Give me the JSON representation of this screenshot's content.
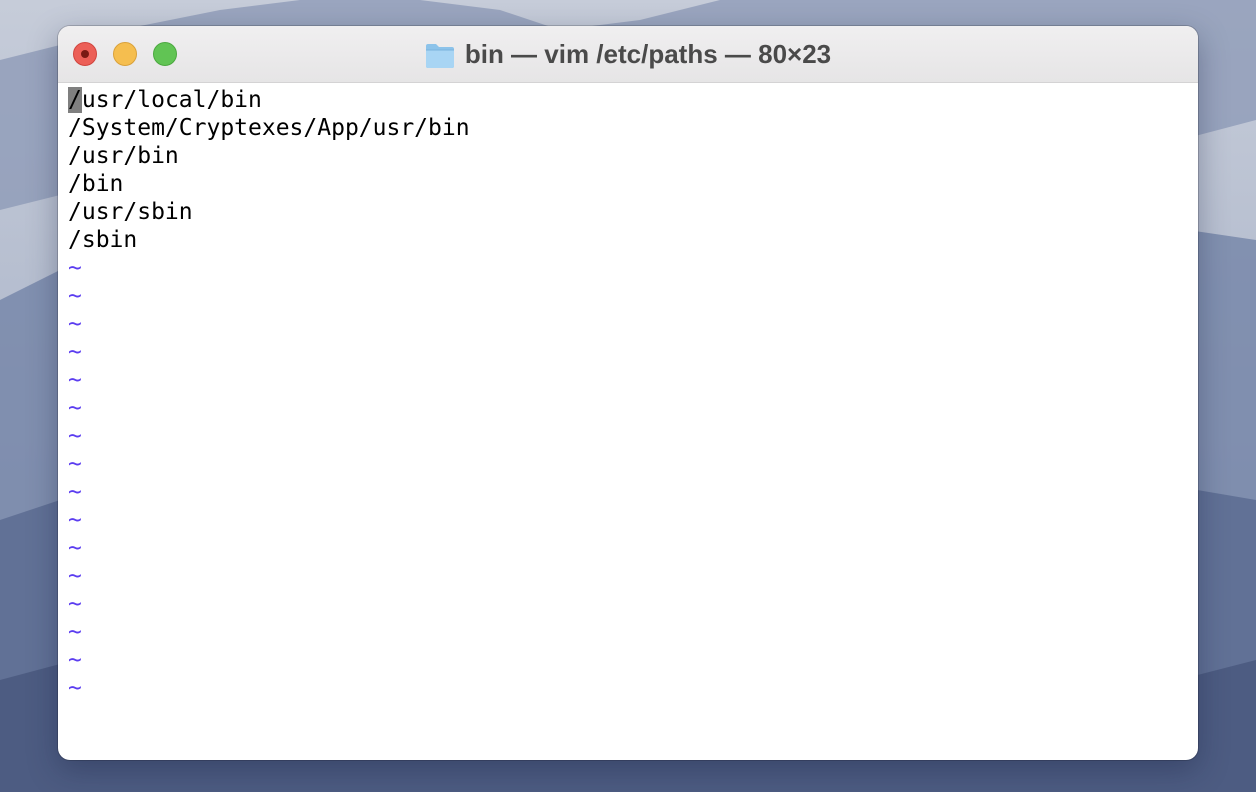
{
  "window": {
    "title": "bin — vim /etc/paths — 80×23",
    "folder_icon": "folder-icon",
    "controls": [
      "close-button",
      "minimize-button",
      "zoom-button"
    ]
  },
  "editor": {
    "cursor_char": "/",
    "lines": [
      "usr/local/bin",
      "/System/Cryptexes/App/usr/bin",
      "/usr/bin",
      "/bin",
      "/usr/sbin",
      "/sbin"
    ],
    "empty_line_marker": "~",
    "empty_line_count": 16
  },
  "colors": {
    "tilde": "#5b3df0",
    "cursor_bg": "#7f7f7f",
    "close": "#ec5f57",
    "minimize": "#f5be4f",
    "zoom": "#61c454"
  }
}
